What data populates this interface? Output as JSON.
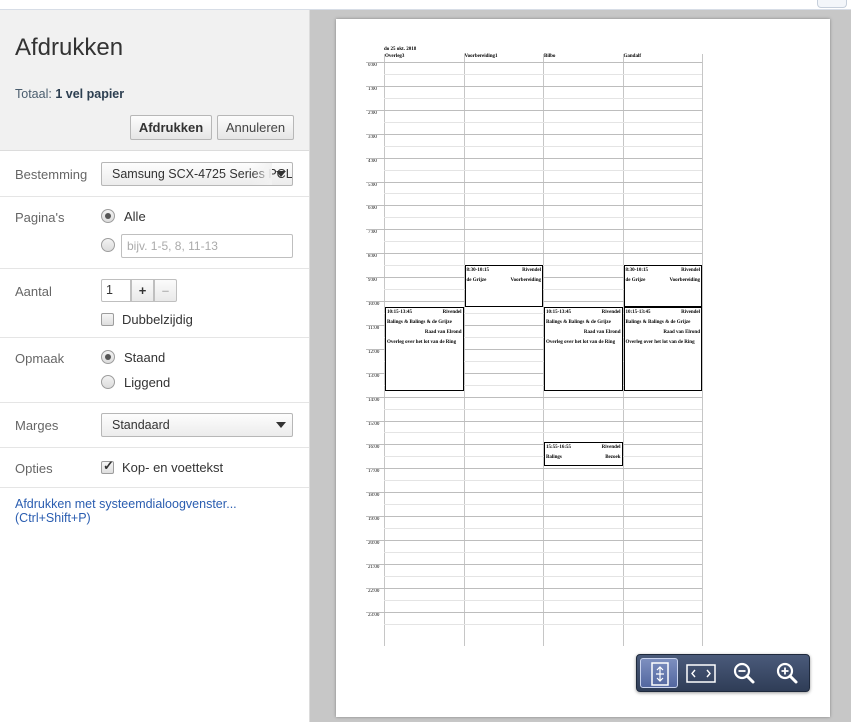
{
  "header": {
    "title": "Afdrukken",
    "total_label": "Totaal:",
    "total_value": "1 vel papier",
    "print_button": "Afdrukken",
    "cancel_button": "Annuleren"
  },
  "destination": {
    "label": "Bestemming",
    "value": "Samsung SCX-4725 Series PCL"
  },
  "pages": {
    "label": "Pagina's",
    "option_all": "Alle",
    "custom_placeholder": "bijv. 1-5, 8, 11-13",
    "selected": "all"
  },
  "copies": {
    "label": "Aantal",
    "value": "1",
    "plus": "+",
    "minus": "–",
    "duplex_label": "Dubbelzijdig",
    "duplex_checked": false
  },
  "layout": {
    "label": "Opmaak",
    "portrait": "Staand",
    "landscape": "Liggend",
    "selected": "portrait"
  },
  "margins": {
    "label": "Marges",
    "value": "Standaard"
  },
  "options": {
    "label": "Opties",
    "header_footer_label": "Kop- en voettekst",
    "header_footer_checked": true
  },
  "system_dialog_link": "Afdrukken met systeemdialoogvenster... (Ctrl+Shift+P)",
  "preview": {
    "date": "do 25 okt. 2018",
    "columns": [
      "Overleg3",
      "Voorbereiding1",
      "Bilbo",
      "Gandalf"
    ],
    "hours": [
      "0:00",
      "1:00",
      "2:00",
      "3:00",
      "4:00",
      "5:00",
      "6:00",
      "7:00",
      "8:00",
      "9:00",
      "10:00",
      "11:00",
      "12:00",
      "13:00",
      "14:00",
      "15:00",
      "16:00",
      "17:00",
      "18:00",
      "19:00",
      "20:00",
      "21:00",
      "22:00",
      "23:00"
    ],
    "events": [
      {
        "column": 1,
        "start": 8.5,
        "end": 10.25,
        "lines": [
          [
            "8:30-10:15",
            "Rivendel"
          ],
          [
            "de Grijze",
            "Voorbereiding"
          ]
        ]
      },
      {
        "column": 3,
        "start": 8.5,
        "end": 10.25,
        "lines": [
          [
            "8:30-10:15",
            "Rivendel"
          ],
          [
            "de Grijze",
            "Voorbereiding"
          ]
        ]
      },
      {
        "column": 0,
        "start": 10.25,
        "end": 13.75,
        "lines": [
          [
            "10:15-13:45",
            "Rivendel"
          ],
          [
            "Balings & Balings & de Grijze",
            ""
          ],
          [
            "",
            "Raad van Elrond"
          ],
          [
            "Overleg over het lot van de Ring",
            ""
          ]
        ]
      },
      {
        "column": 2,
        "start": 10.25,
        "end": 13.75,
        "lines": [
          [
            "10:15-13:45",
            "Rivendel"
          ],
          [
            "Balings & Balings & de Grijze",
            ""
          ],
          [
            "",
            "Raad van Elrond"
          ],
          [
            "Overleg over het lot van de Ring",
            ""
          ]
        ]
      },
      {
        "column": 3,
        "start": 10.25,
        "end": 13.75,
        "lines": [
          [
            "10:15-13:45",
            "Rivendel"
          ],
          [
            "Balings & Balings & de Grijze",
            ""
          ],
          [
            "",
            "Raad van Elrond"
          ],
          [
            "Overleg over het lot van de Ring",
            ""
          ]
        ]
      },
      {
        "column": 2,
        "start": 15.9166,
        "end": 16.9166,
        "lines": [
          [
            "15:55-16:55",
            "Rivendel"
          ],
          [
            "Balings",
            "Bezoek"
          ]
        ]
      }
    ]
  },
  "zoom_controls": [
    "fit-to-page-icon",
    "fit-to-width-icon",
    "zoom-out-icon",
    "zoom-in-icon"
  ]
}
